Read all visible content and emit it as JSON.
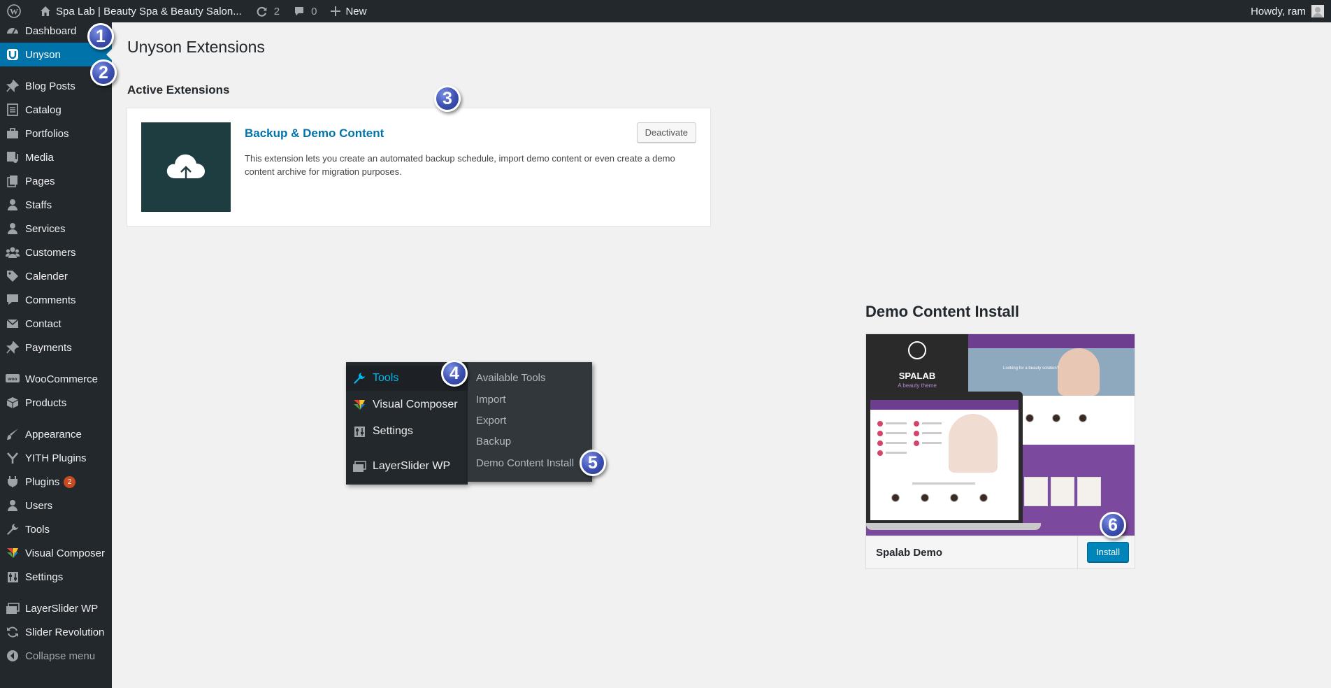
{
  "admin_bar": {
    "site_name": "Spa Lab | Beauty Spa & Beauty Salon...",
    "updates_count": "2",
    "comments_count": "0",
    "new_label": "New",
    "greeting": "Howdy, ram"
  },
  "sidebar": {
    "items": [
      {
        "label": "Dashboard",
        "icon": "dashboard-icon"
      },
      {
        "label": "Unyson",
        "icon": "unyson-icon",
        "current": true
      },
      {
        "label": "Blog Posts",
        "icon": "pin-icon"
      },
      {
        "label": "Catalog",
        "icon": "catalog-icon"
      },
      {
        "label": "Portfolios",
        "icon": "portfolio-icon"
      },
      {
        "label": "Media",
        "icon": "media-icon"
      },
      {
        "label": "Pages",
        "icon": "pages-icon"
      },
      {
        "label": "Staffs",
        "icon": "user-icon"
      },
      {
        "label": "Services",
        "icon": "user-icon"
      },
      {
        "label": "Customers",
        "icon": "groups-icon"
      },
      {
        "label": "Calender",
        "icon": "tag-icon"
      },
      {
        "label": "Comments",
        "icon": "comments-icon"
      },
      {
        "label": "Contact",
        "icon": "email-icon"
      },
      {
        "label": "Payments",
        "icon": "pin-icon"
      },
      {
        "label": "WooCommerce",
        "icon": "woocommerce-icon"
      },
      {
        "label": "Products",
        "icon": "products-icon"
      },
      {
        "label": "Appearance",
        "icon": "appearance-icon"
      },
      {
        "label": "YITH Plugins",
        "icon": "yith-icon"
      },
      {
        "label": "Plugins",
        "icon": "plugins-icon",
        "badge": "2"
      },
      {
        "label": "Users",
        "icon": "user-icon"
      },
      {
        "label": "Tools",
        "icon": "wrench-icon"
      },
      {
        "label": "Visual Composer",
        "icon": "vc-icon"
      },
      {
        "label": "Settings",
        "icon": "settings-icon"
      },
      {
        "label": "LayerSlider WP",
        "icon": "layers-icon"
      },
      {
        "label": "Slider Revolution",
        "icon": "refresh-icon"
      },
      {
        "label": "Collapse menu",
        "icon": "collapse-icon"
      }
    ]
  },
  "main": {
    "page_title": "Unyson Extensions",
    "section_title": "Active Extensions",
    "extension": {
      "title": "Backup & Demo Content",
      "description": "This extension lets you create an automated backup schedule, import demo content or even create a demo content archive for migration purposes.",
      "button_label": "Deactivate"
    }
  },
  "tools_menu": {
    "main_items": [
      "Tools",
      "Visual Composer",
      "Settings",
      "LayerSlider WP"
    ],
    "sub_items": [
      "Available Tools",
      "Import",
      "Export",
      "Backup",
      "Demo Content Install"
    ],
    "active_color": "#00b9eb"
  },
  "demo_install": {
    "heading": "Demo Content Install",
    "demo_name": "Spalab Demo",
    "install_label": "Install",
    "preview": {
      "brand": "SPALAB",
      "tagline": "A beauty theme",
      "hero_text": "Looking for a beauty solution?"
    }
  },
  "callouts": [
    "1",
    "2",
    "3",
    "4",
    "5",
    "6"
  ],
  "colors": {
    "admin_dark": "#23282d",
    "accent_blue": "#0073aa",
    "primary_button": "#0085ba",
    "badge_orange": "#ca4a1f",
    "callout_blue": "#3c4fb0"
  }
}
